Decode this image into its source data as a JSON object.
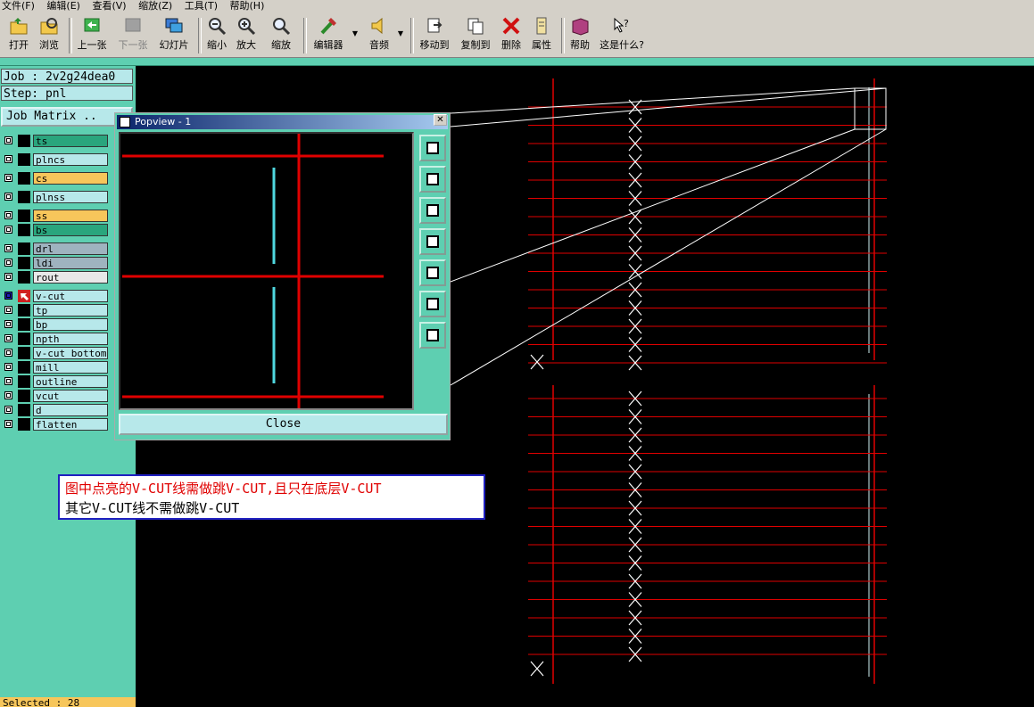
{
  "menu": [
    "文件(F)",
    "编辑(E)",
    "查看(V)",
    "缩放(Z)",
    "工具(T)",
    "帮助(H)"
  ],
  "toolbar": {
    "open": "打开",
    "browse": "浏览",
    "prev": "上一张",
    "next": "下一张",
    "slideshow": "幻灯片",
    "zoom_out": "缩小",
    "zoom_in": "放大",
    "zoom": "缩放",
    "editor": "编辑器",
    "audio": "音频",
    "move_to": "移动到",
    "copy_to": "复制到",
    "delete": "删除",
    "properties": "属性",
    "help": "帮助",
    "whats_this": "这是什么?"
  },
  "job": {
    "job_label": "Job : 2v2g24dea0",
    "step_label": "Step: pnl",
    "matrix_button": "Job Matrix .."
  },
  "layers": [
    {
      "name": "ts",
      "color": "#2aa57d"
    },
    {
      "name": "plncs",
      "color": "#b7e8ea"
    },
    {
      "name": "cs",
      "color": "#f7c65b"
    },
    {
      "name": "plnss",
      "color": "#b7e8ea"
    },
    {
      "name": "ss",
      "color": "#f7c65b"
    },
    {
      "name": "bs",
      "color": "#2aa57d"
    },
    {
      "name": "drl",
      "color": "#9fb3bf"
    },
    {
      "name": "ldi",
      "color": "#9fb3bf"
    },
    {
      "name": "rout",
      "color": "#e8e8e8"
    },
    {
      "name": "v-cut",
      "color": "#b7e8ea"
    },
    {
      "name": "tp",
      "color": "#b7e8ea"
    },
    {
      "name": "bp",
      "color": "#b7e8ea"
    },
    {
      "name": "npth",
      "color": "#b7e8ea"
    },
    {
      "name": "v-cut_bottom",
      "color": "#b7e8ea"
    },
    {
      "name": "mill",
      "color": "#b7e8ea"
    },
    {
      "name": "outline",
      "color": "#b7e8ea"
    },
    {
      "name": "vcut",
      "color": "#b7e8ea"
    },
    {
      "name": "d",
      "color": "#b7e8ea"
    },
    {
      "name": "flatten",
      "color": "#b7e8ea"
    }
  ],
  "status": {
    "selected": "Selected : 28"
  },
  "popup": {
    "title": "Popview - 1",
    "close_label": "Close"
  },
  "note": {
    "line1": "图中点亮的V-CUT线需做跳V-CUT,且只在底层V-CUT",
    "line2": "其它V-CUT线不需做跳V-CUT"
  },
  "colors": {
    "panel": "#5ecfb1",
    "line": "#e00000",
    "highlight": "#4fd8e0"
  }
}
